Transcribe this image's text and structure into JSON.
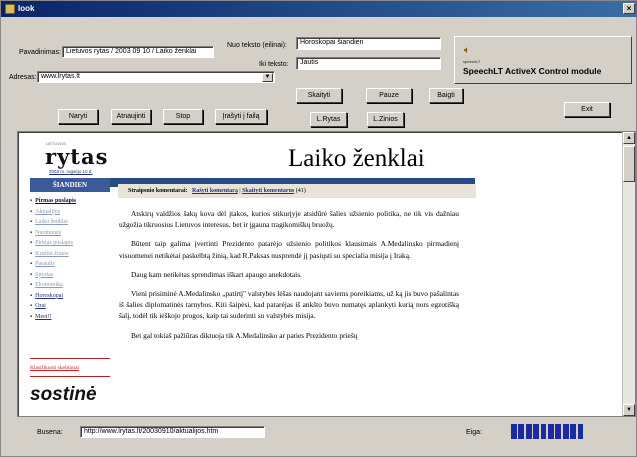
{
  "window": {
    "title": "look",
    "close_glyph": "×"
  },
  "form": {
    "pavadinimas_label": "Pavadinimas:",
    "pavadinimas_value": "Lietuvos rytas / 2003 09 10 / Laiko ženklai",
    "adresas_label": "Adresas:",
    "adresas_value": "www.lrytas.lt",
    "nuo_teksto_label": "Nuo teksto (eilinai):",
    "nuo_teksto_value": "Horoskopai šiandien",
    "iki_teksto_label": "Iki teksto:",
    "iki_teksto_value": "Jautis"
  },
  "buttons": {
    "skaityti": "Skaityti",
    "pauze": "Pauze",
    "baigti": "Baigti",
    "exit": "Exit",
    "naryti": "Naryti",
    "atnaujinti": "Atnaujinti",
    "stop": "Stop",
    "irasyti": "Įrašyti į failą",
    "lrytas": "L.Rytas",
    "lzinios": "L.Zinios"
  },
  "speech_control": {
    "small_text": "speechLT",
    "title": "SpeechLT ActiveX Control module",
    "icon": "speaker-icon"
  },
  "page": {
    "logo_small": "LIETUVOS",
    "logo": "rytas",
    "date_link": "2003 m. rugsėjo 10 d.",
    "headline": "Laiko ženklai",
    "left_header": "ŠIANDIEN",
    "comments": {
      "label": "Straipsnio komentarai:",
      "write": "Rašyti komentarą",
      "sep": " | ",
      "read": "Skaityti komentarus",
      "count": "(41)"
    },
    "nav": [
      {
        "label": "Pirmas puslapis",
        "style": "strong"
      },
      {
        "label": "Aktualijos",
        "style": "dim"
      },
      {
        "label": "Laiko ženklai",
        "style": "dim"
      },
      {
        "label": "Nuomonės",
        "style": "dim"
      },
      {
        "label": "Pirktas puslapis",
        "style": "dim"
      },
      {
        "label": "Kraštui žinios",
        "style": "dim"
      },
      {
        "label": "Pasaulis",
        "style": "dim"
      },
      {
        "label": "Sportas",
        "style": "dim"
      },
      {
        "label": "Ekonomika",
        "style": "dim"
      },
      {
        "label": "Horoskopai",
        "style": "normal"
      },
      {
        "label": "Orai",
        "style": "normal"
      },
      {
        "label": "Meet!!",
        "style": "normal"
      }
    ],
    "classified": "Klasifikuoti skelbimai",
    "sostine": "sostinė",
    "paragraphs": [
      "Atskirų valdžios šakų kova dėl įtakos, kurios stikurįyje atsidūrė šalies užsienio politika, ne tik vis dažniau užgožia tikruosius Lietuvos interesus, bet ir įgauna tragikomiškų bruožų.",
      "Būtent taip galima įvertinti Prezidento patarėjo užsienio politikos klausimais A.Medalinsko pirmadienį visuomenei netikėtai paskelbtą žinią, kad R.Paksas nusprendė jį pasiųsti su specialia misija į Iraką.",
      "Daug kam netikėtas sprendimas iškart apaugo anekdotais.",
      "Vieni prisiminė A.Medalinsko „patirtį\" valstybės lėšas naudojant saviems poreikiams, už ką jis buvo pašalintas iš šalies diplomatinės tarnybos. Kiti šaipėsi, kad patarėjas iš ankšto buvo numatęs aplankyti kurią nors egzotišką šalį, todėl tik ieškojo progos, kaip tai suderinti su valstybės misija.",
      "Bet gal tokiaš pažiūras diktuoja tik A.Medalinsko ar paties Prezidento priešų"
    ]
  },
  "status": {
    "busena_label": "Busena:",
    "url": "http://www.lrytas.lt/20030910/aktualijos.htm",
    "eiga_label": "Eiga:",
    "progress_segments_filled": 10,
    "progress_segments_total": 10,
    "progress_color": "#1a2aa0"
  },
  "colors": {
    "title_bar": "#0a246a",
    "face": "#d4d0c8",
    "link": "#223377",
    "nav_header": "#3a5a9a"
  }
}
